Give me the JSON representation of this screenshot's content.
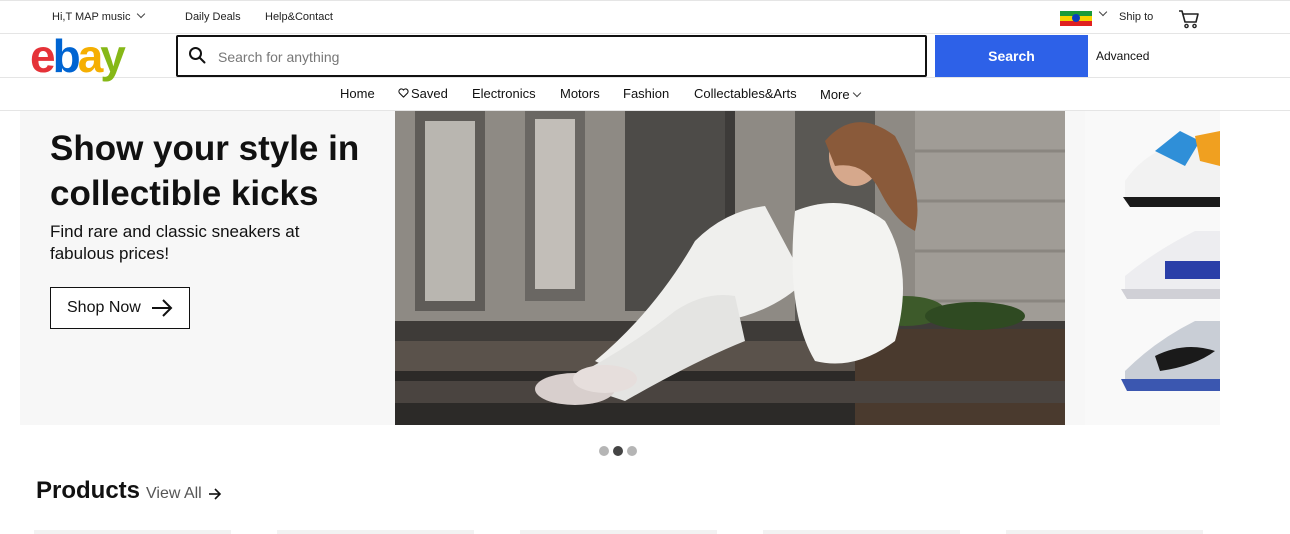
{
  "topbar": {
    "greeting": "Hi,T MAP music",
    "daily_deals": "Daily Deals",
    "help_contact": "Help&Contact",
    "ship_to": "Ship to"
  },
  "header": {
    "logo": [
      "e",
      "b",
      "a",
      "y"
    ],
    "search_placeholder": "Search for anything",
    "search_button": "Search",
    "advanced": "Advanced"
  },
  "nav": {
    "items": [
      "Home",
      "Saved",
      "Electronics",
      "Motors",
      "Fashion",
      "Collectables&Arts",
      "More"
    ]
  },
  "hero": {
    "title": "Show your style in collectible kicks",
    "subtitle": "Find rare and classic sneakers at fabulous prices!",
    "cta": "Shop Now",
    "carousel_active_index": 1,
    "carousel_count": 3
  },
  "products": {
    "title": "Products",
    "view_all": "View All"
  },
  "colors": {
    "search_button": "#2d61e8",
    "logo_e": "#e53238",
    "logo_b": "#0064d2",
    "logo_a": "#f5af02",
    "logo_y": "#86b817"
  }
}
